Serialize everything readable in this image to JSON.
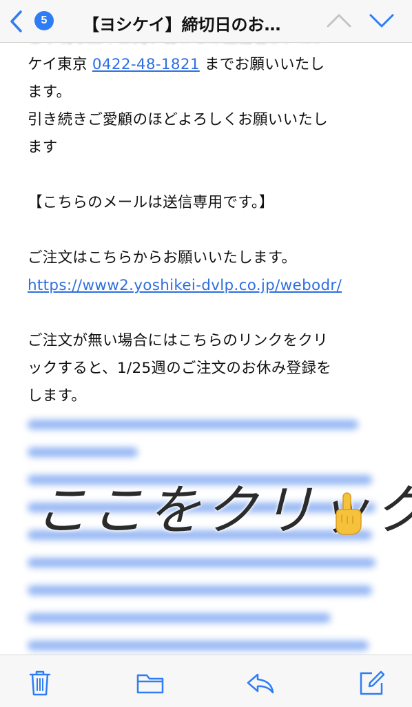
{
  "navbar": {
    "unread_count": "5",
    "title": "【ヨシケイ】締切日のお…"
  },
  "email": {
    "partial_top": "ご不明な点やお問い合わせは担当者か、ヨシ",
    "line1_prefix": "ケイ東京 ",
    "phone": "0422-48-1821",
    "line1_suffix": " までお願いいたし",
    "line2": "ます。",
    "line3": "引き続きご愛顧のほどよろしくお願いいたし",
    "line4": "ます",
    "notice": "【こちらのメールは送信専用です。】",
    "order_text": "ご注文はこちらからお願いいたします。",
    "order_url": "https://www2.yoshikei-dvlp.co.jp/webodr/",
    "skip_line1": "ご注文が無い場合にはこちらのリンクをクリ",
    "skip_line2": "ックすると、1/25週のご注文のお休み登録を",
    "skip_line3": "します。"
  },
  "overlay": {
    "text": "ここをクリック"
  },
  "colors": {
    "link": "#2d6fe0",
    "accent": "#2f7df6",
    "bar_bg": "#f7f7f7"
  },
  "icons": {
    "back": "chevron-left-icon",
    "up": "chevron-up-icon",
    "down": "chevron-down-icon",
    "finger": "pointing-finger-icon",
    "trash": "trash-icon",
    "folder": "folder-icon",
    "reply": "reply-icon",
    "compose": "compose-icon"
  }
}
